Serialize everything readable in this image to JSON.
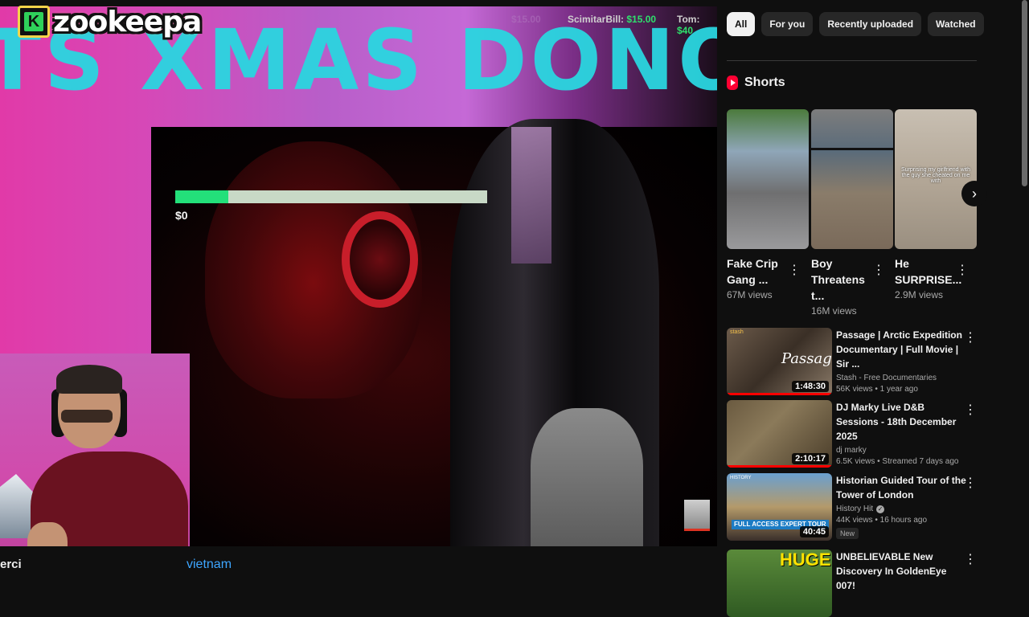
{
  "player": {
    "overlay_title": "TS XMAS DONO.",
    "logo_letter": "K",
    "logo_text": "zookeepa",
    "goal_amount": "$0",
    "goal_progress": 0.17,
    "donations": [
      {
        "name": "ScimitarBill:",
        "amount": "$15.00"
      },
      {
        "name": "Tom:",
        "amount": "$40"
      }
    ],
    "faint_donation": "$15.00",
    "bottom_left_text": "erci",
    "bottom_right_text": "vietnam"
  },
  "chips": [
    {
      "label": "All",
      "active": true
    },
    {
      "label": "For you",
      "active": false
    },
    {
      "label": "Recently uploaded",
      "active": false
    },
    {
      "label": "Watched",
      "active": false
    }
  ],
  "shorts": {
    "heading": "Shorts",
    "items": [
      {
        "title": "Fake Crip Gang ...",
        "views": "67M views"
      },
      {
        "title": "Boy Threatens t...",
        "views": "16M views"
      },
      {
        "title": "He SURPRISE...",
        "views": "2.9M views",
        "caption": "Surprising my girlfriend with the guy she cheated on me with"
      }
    ],
    "menu_glyph": "⋮",
    "next_glyph": "›"
  },
  "videos": [
    {
      "title": "Passage | Arctic Expedition Documentary | Full Movie | Sir ...",
      "channel": "Stash - Free Documentaries",
      "meta": "56K views • 1 year ago",
      "duration": "1:48:30",
      "thumb_text": "Passage",
      "thumb_tag": "stash",
      "verified": false,
      "badge": ""
    },
    {
      "title": "DJ Marky Live D&B Sessions - 18th December 2025",
      "channel": "dj marky",
      "meta": "6.5K views • Streamed 7 days ago",
      "duration": "2:10:17",
      "verified": false,
      "badge": ""
    },
    {
      "title": "Historian Guided Tour of the Tower of London",
      "channel": "History Hit",
      "meta": "44K views • 16 hours ago",
      "duration": "40:45",
      "thumb_tag": "HISTORY",
      "thumb_text": "FULL ACCESS EXPERT TOUR",
      "verified": true,
      "badge": "New"
    },
    {
      "title": "UNBELIEVABLE New Discovery In GoldenEye 007!",
      "channel": "",
      "meta": "",
      "duration": "",
      "thumb_text": "HUGE",
      "verified": false,
      "badge": ""
    }
  ],
  "colors": {
    "overlay_title": "#2ad6e0",
    "donation_amount": "#2ee06c",
    "link": "#3ea6ff",
    "shorts_red": "#ff0033"
  }
}
